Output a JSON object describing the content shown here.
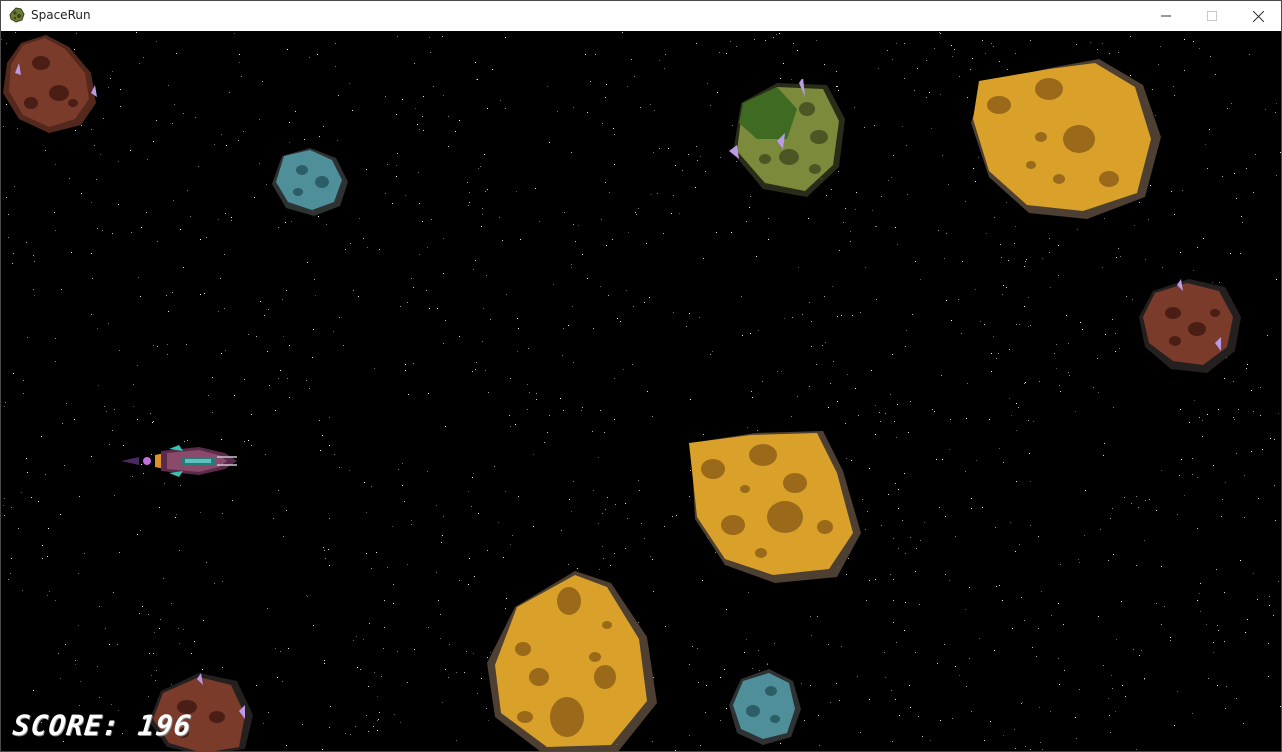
{
  "window": {
    "title": "SpaceRun",
    "icon": "asteroid-icon",
    "controls": [
      "minimize-icon",
      "maximize-icon",
      "close-icon"
    ]
  },
  "game": {
    "background_color": "#000000",
    "score_label": "SCORE:",
    "score_value": 196,
    "score_text": "SCORE: 196",
    "player": {
      "sprite": "spaceship"
    },
    "asteroids": [
      {
        "kind": "brown",
        "color": "#7a3b2a"
      },
      {
        "kind": "blue",
        "color": "#4f8f9a"
      },
      {
        "kind": "green",
        "color": "#7c8a3c"
      },
      {
        "kind": "yellow",
        "color": "#d9a12a"
      },
      {
        "kind": "brown",
        "color": "#7a3b2a"
      },
      {
        "kind": "yellow",
        "color": "#d9a12a"
      },
      {
        "kind": "yellow",
        "color": "#d9a12a"
      },
      {
        "kind": "blue",
        "color": "#4f8f9a"
      },
      {
        "kind": "brown",
        "color": "#7a3b2a"
      }
    ]
  }
}
